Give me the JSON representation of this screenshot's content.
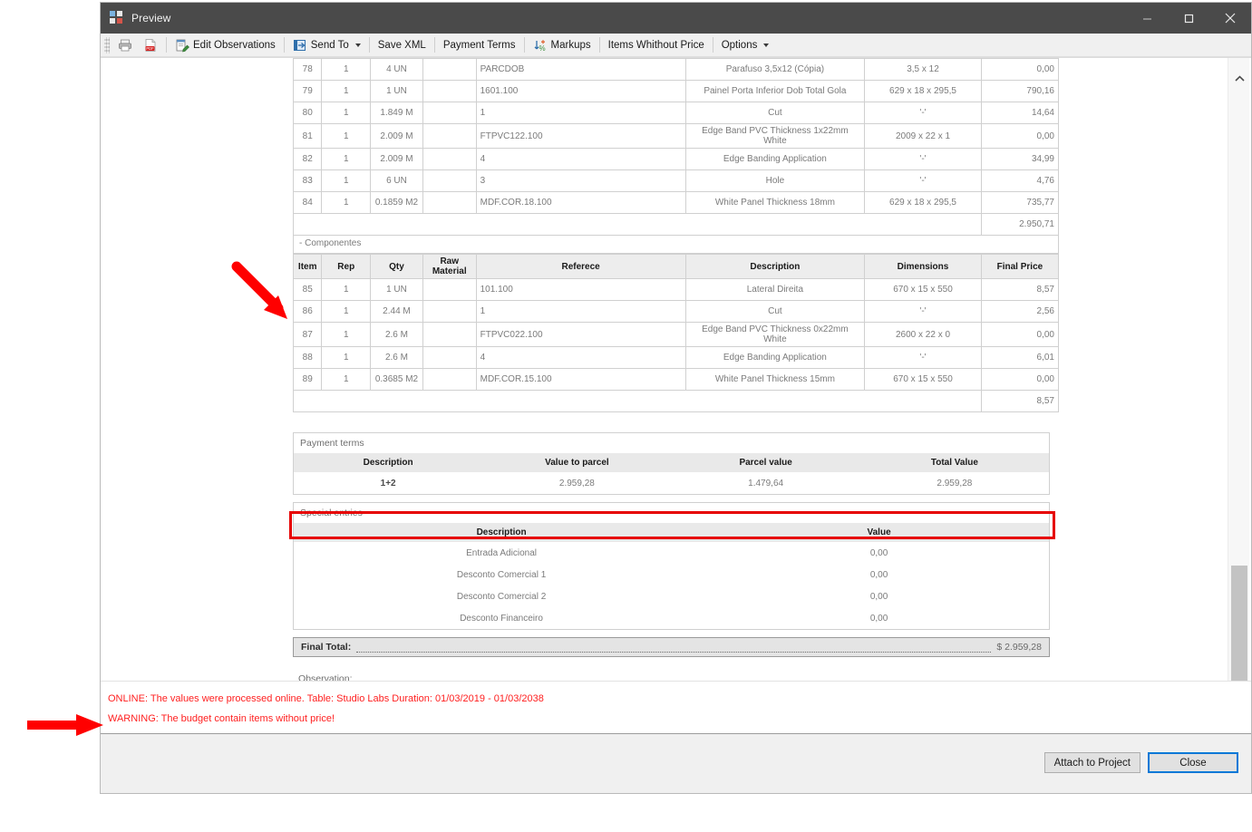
{
  "window": {
    "title": "Preview",
    "icon": "preview-window-icon",
    "controls": {
      "minimize": "Minimize",
      "maximize": "Maximize",
      "close": "Close"
    }
  },
  "toolbar": {
    "items": [
      {
        "label": "",
        "icon": "print-icon",
        "name": "print-button"
      },
      {
        "label": "",
        "icon": "pdf-icon",
        "name": "export-pdf-button"
      },
      {
        "label": "Edit Observations",
        "icon": "edit-observations-icon",
        "name": "edit-observations-button"
      },
      {
        "label": "Send To",
        "icon": "send-to-icon",
        "name": "send-to-button",
        "caret": true
      },
      {
        "label": "Save XML",
        "icon": "",
        "name": "save-xml-button"
      },
      {
        "label": "Payment Terms",
        "icon": "",
        "name": "payment-terms-button"
      },
      {
        "label": "Markups",
        "icon": "markups-icon",
        "name": "markups-button"
      },
      {
        "label": "Items Whithout Price",
        "icon": "",
        "name": "items-without-price-button"
      },
      {
        "label": "Options",
        "icon": "",
        "name": "options-button",
        "caret": true
      }
    ]
  },
  "document": {
    "top_table": {
      "rows": [
        {
          "item": "78",
          "rep": "1",
          "qty": "4 UN",
          "raw": "",
          "ref": "PARCDOB",
          "desc": "Parafuso 3,5x12 (Cópia)",
          "dim": "3,5 x 12",
          "price": "0,00"
        },
        {
          "item": "79",
          "rep": "1",
          "qty": "1 UN",
          "raw": "",
          "ref": "1601.100",
          "desc": "Painel Porta Inferior Dob Total Gola",
          "dim": "629 x 18 x 295,5",
          "price": "790,16"
        },
        {
          "item": "80",
          "rep": "1",
          "qty": "1.849 M",
          "raw": "",
          "ref": "1",
          "desc": "Cut",
          "dim": "'-'",
          "price": "14,64"
        },
        {
          "item": "81",
          "rep": "1",
          "qty": "2.009 M",
          "raw": "",
          "ref": "FTPVC122.100",
          "desc": "Edge Band PVC Thickness 1x22mm White",
          "dim": "2009 x 22 x 1",
          "price": "0,00"
        },
        {
          "item": "82",
          "rep": "1",
          "qty": "2.009 M",
          "raw": "",
          "ref": "4",
          "desc": "Edge Banding Application",
          "dim": "'-'",
          "price": "34,99"
        },
        {
          "item": "83",
          "rep": "1",
          "qty": "6 UN",
          "raw": "",
          "ref": "3",
          "desc": "Hole",
          "dim": "'-'",
          "price": "4,76"
        },
        {
          "item": "84",
          "rep": "1",
          "qty": "0.1859 M2",
          "raw": "",
          "ref": "MDF.COR.18.100",
          "desc": "White Panel Thickness 18mm",
          "dim": "629 x 18 x 295,5",
          "price": "735,77"
        }
      ],
      "subtotal": "2.950,71"
    },
    "components_section_label": "- Componentes",
    "components_table": {
      "headers": {
        "item": "Item",
        "rep": "Rep",
        "qty": "Qty",
        "raw": "Raw Material",
        "ref": "Referece",
        "desc": "Description",
        "dim": "Dimensions",
        "price": "Final Price"
      },
      "rows": [
        {
          "item": "85",
          "rep": "1",
          "qty": "1 UN",
          "raw": "",
          "ref": "101.100",
          "desc": "Lateral Direita",
          "dim": "670 x 15 x 550",
          "price": "8,57"
        },
        {
          "item": "86",
          "rep": "1",
          "qty": "2.44 M",
          "raw": "",
          "ref": "1",
          "desc": "Cut",
          "dim": "'-'",
          "price": "2,56"
        },
        {
          "item": "87",
          "rep": "1",
          "qty": "2.6 M",
          "raw": "",
          "ref": "FTPVC022.100",
          "desc": "Edge Band PVC Thickness 0x22mm White",
          "dim": "2600 x 22 x 0",
          "price": "0,00"
        },
        {
          "item": "88",
          "rep": "1",
          "qty": "2.6 M",
          "raw": "",
          "ref": "4",
          "desc": "Edge Banding Application",
          "dim": "'-'",
          "price": "6,01"
        },
        {
          "item": "89",
          "rep": "1",
          "qty": "0.3685 M2",
          "raw": "",
          "ref": "MDF.COR.15.100",
          "desc": "White Panel Thickness 15mm",
          "dim": "670 x 15 x 550",
          "price": "0,00"
        }
      ],
      "subtotal": "8,57"
    },
    "payment_terms": {
      "title": "Payment terms",
      "headers": {
        "description": "Description",
        "value_to_parcel": "Value to parcel",
        "parcel_value": "Parcel value",
        "total_value": "Total Value"
      },
      "rows": [
        {
          "description": "1+2",
          "value_to_parcel": "2.959,28",
          "parcel_value": "1.479,64",
          "total_value": "2.959,28"
        }
      ]
    },
    "special_entries": {
      "title": "Special entries",
      "headers": {
        "description": "Description",
        "value": "Value"
      },
      "rows": [
        {
          "description": "Entrada Adicional",
          "value": "0,00"
        },
        {
          "description": "Desconto Comercial 1",
          "value": "0,00"
        },
        {
          "description": "Desconto Comercial 2",
          "value": "0,00"
        },
        {
          "description": "Desconto Financeiro",
          "value": "0,00"
        }
      ]
    },
    "final_total": {
      "label": "Final Total:",
      "value": "$ 2.959,28"
    },
    "observation": {
      "label": "Observation:"
    }
  },
  "status_messages": {
    "online": "ONLINE: The values were processed online. Table: Studio Labs Duration: 01/03/2019 - 01/03/2038",
    "warning": "WARNING: The budget contain items without price!"
  },
  "footer": {
    "attach_label": "Attach to Project",
    "close_label": "Close"
  },
  "annotations": {
    "highlight_color": "#e60000",
    "arrow_color": "#ff0000"
  }
}
